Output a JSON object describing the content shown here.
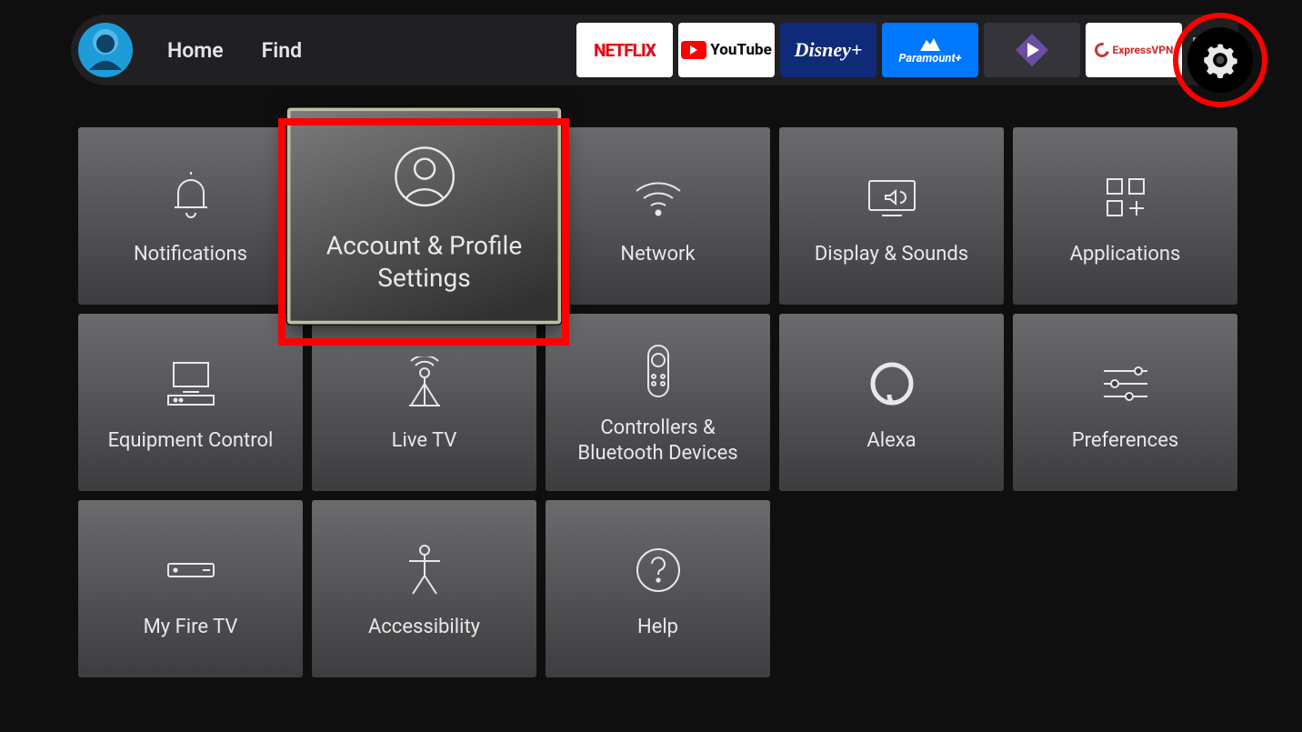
{
  "nav": {
    "home": "Home",
    "find": "Find"
  },
  "apps": {
    "netflix": "NETFLIX",
    "youtube": "YouTube",
    "disney": "Disney+",
    "paramount": "Paramount+",
    "expressvpn": "ExpressVPN"
  },
  "tiles": {
    "notifications": "Notifications",
    "account": "Account & Profile Settings",
    "network": "Network",
    "display": "Display & Sounds",
    "applications": "Applications",
    "equipment": "Equipment Control",
    "livetv": "Live TV",
    "controllers": "Controllers & Bluetooth Devices",
    "alexa": "Alexa",
    "preferences": "Preferences",
    "myfiretv": "My Fire TV",
    "accessibility": "Accessibility",
    "help": "Help"
  }
}
